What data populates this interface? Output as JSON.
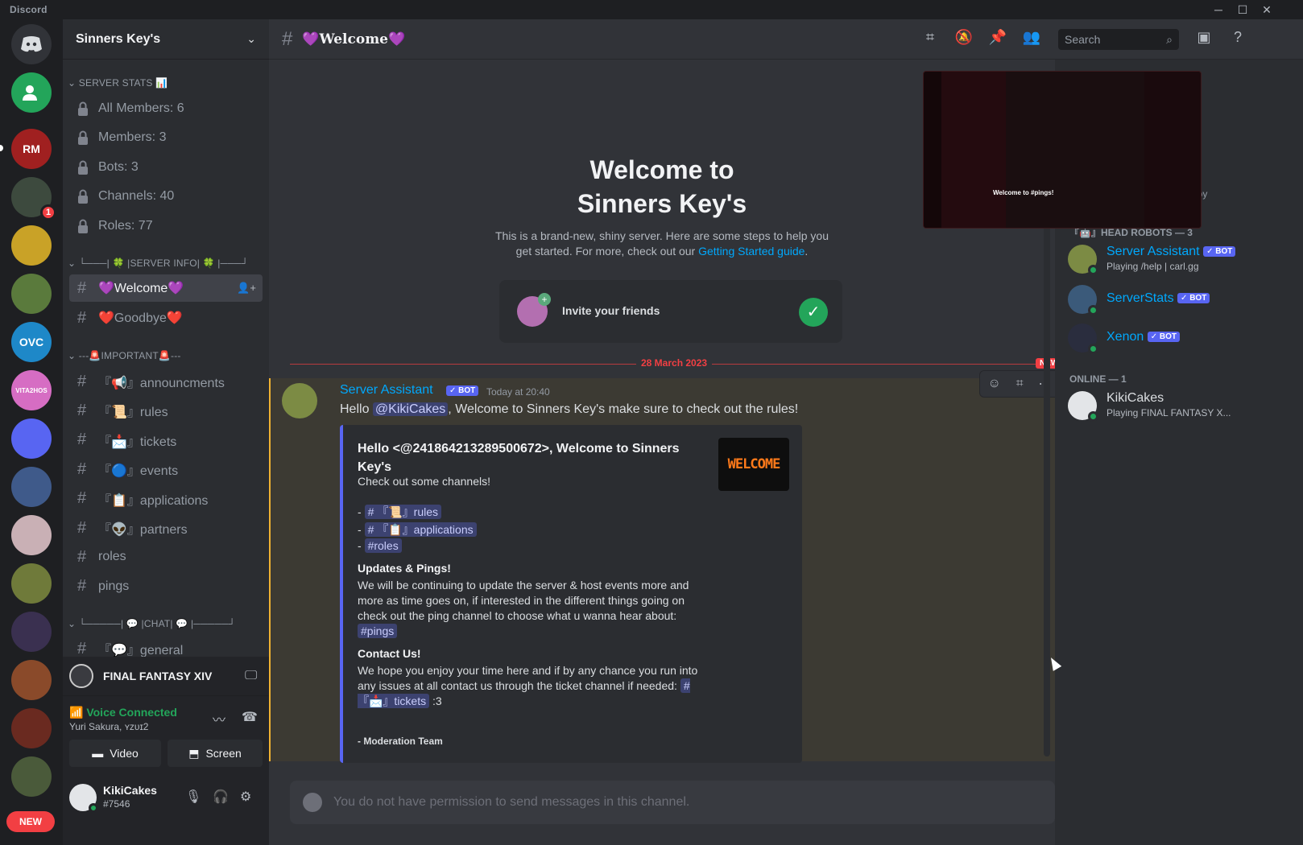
{
  "window": {
    "app_name": "Discord"
  },
  "server": {
    "name": "Sinners Key's"
  },
  "rail": {
    "servers": [
      {
        "label": "RM",
        "color": "#a02020"
      },
      {
        "label": "",
        "color": "#3d4a3e",
        "badge": "1"
      },
      {
        "label": "",
        "color": "#c9a227"
      },
      {
        "label": "",
        "color": "#5a7a3c"
      },
      {
        "label": "OVC",
        "color": "#1e88c8"
      },
      {
        "label": "VITA2HOS",
        "color": "#d66dc3"
      },
      {
        "label": "",
        "color": "#5865f2"
      },
      {
        "label": "",
        "color": "#3f5a8a"
      },
      {
        "label": "",
        "color": "#c9b0b5"
      },
      {
        "label": "",
        "color": "#6f7a3a"
      },
      {
        "label": "",
        "color": "#3a3050"
      },
      {
        "label": "",
        "color": "#8a4a2a"
      },
      {
        "label": "",
        "color": "#6a2a20"
      },
      {
        "label": "",
        "color": "#4a5a3a"
      }
    ],
    "new_label": "NEW"
  },
  "categories": {
    "stats": "SERVER STATS 📊",
    "info": "└───| 🍀 |SERVER INFO| 🍀 |───┘",
    "important": "---🚨IMPORTANT🚨---",
    "chat": "└─────| 💬 |CHAT| 💬 |─────┘"
  },
  "stats_channels": [
    "All Members: 6",
    "Members: 3",
    "Bots: 3",
    "Channels: 40",
    "Roles: 77"
  ],
  "info_channels": [
    "💜Welcome💜",
    "❤️Goodbye❤️"
  ],
  "important_channels": [
    "『📢』announcments",
    "『📜』rules",
    "『📩』tickets",
    "『🔵』events",
    "『📋』applications",
    "『👽』partners",
    "roles",
    "pings"
  ],
  "chat_channels": [
    "『💬』general"
  ],
  "game": {
    "name": "FINAL FANTASY XIV"
  },
  "voice": {
    "status": "Voice Connected",
    "location": "Yuri Sakura, ʏᴢᴜɪ2",
    "video_label": "Video",
    "screen_label": "Screen"
  },
  "user": {
    "name": "KikiCakes",
    "tag": "#7546"
  },
  "header": {
    "channel": "💜Welcome💜",
    "search_placeholder": "Search"
  },
  "welcome": {
    "title_line1": "Welcome to",
    "title_line2": "Sinners Key's",
    "desc1": "This is a brand-new, shiny server. Here are some steps to help you",
    "desc2": "get started. For more, check out our",
    "link": "Getting Started guide",
    "desc_end": ".",
    "invite_label": "Invite your friends"
  },
  "divider": {
    "date": "28 March 2023",
    "new": "NEW"
  },
  "message": {
    "author": "Server Assistant",
    "bot": "✓ BOT",
    "time": "Today at 20:40",
    "hello": "Hello",
    "mention": "@KikiCakes",
    "rest": ", Welcome to Sinners Key's make sure to check out the rules!"
  },
  "embed": {
    "title": "Hello <@241864213289500672>, Welcome to Sinners Key's",
    "thumb": "WELCOME",
    "subtitle": "Check out some channels!",
    "links": [
      "# 『📜』rules",
      "# 『📋』applications",
      "#roles"
    ],
    "updates_title": "Updates & Pings!",
    "updates_text": "We will be continuing to update the server & host events more and more as time goes on, if interested in the different things going on check out the ping channel to choose what u wanna hear about:",
    "pings_chip": "#pings",
    "contact_title": "Contact Us!",
    "contact_text": "We hope you enjoy your time here and if by any chance you run into any issues at all contact us through the ticket channel if needed:",
    "tickets_chip": "# 『📩』tickets",
    "contact_end": ":3",
    "footer": "- Moderation Team"
  },
  "composer": {
    "placeholder": "You do not have permission to send messages in this channel."
  },
  "members": {
    "preview_text": "Welcome to #pings!",
    "partial_label": "opy",
    "group1": "『🤖』HEAD ROBOTS — 3",
    "robots": [
      {
        "name": "Server Assistant",
        "status": "Playing /help | carl.gg",
        "color": "#7c8b44"
      },
      {
        "name": "ServerStats",
        "status": "",
        "color": "#3b5a7a"
      },
      {
        "name": "Xenon",
        "status": "",
        "color": "#2a2d3e"
      }
    ],
    "bot_badge": "✓ BOT",
    "group2": "ONLINE — 1",
    "online": [
      {
        "name": "KikiCakes",
        "status": "Playing FINAL FANTASY X...",
        "color": "#e3e5e8"
      }
    ]
  }
}
